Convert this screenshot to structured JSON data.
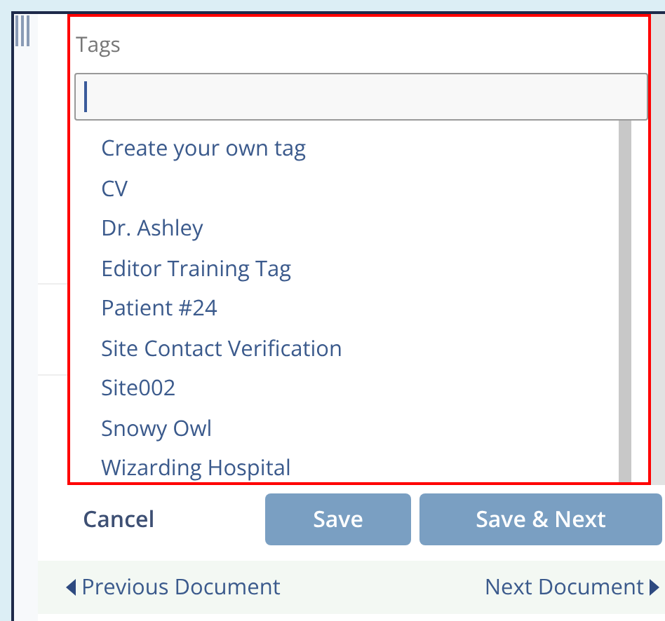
{
  "tags_field": {
    "label": "Tags"
  },
  "tag_options": [
    "Create your own tag",
    "CV",
    "Dr. Ashley",
    "Editor Training Tag",
    "Patient #24",
    "Site Contact Verification",
    "Site002",
    "Snowy Owl",
    "Wizarding Hospital"
  ],
  "actions": {
    "cancel": "Cancel",
    "buttons": [
      "Save",
      "Save & Next"
    ]
  },
  "navigation": {
    "previous": "Previous Document",
    "next": "Next Document"
  }
}
